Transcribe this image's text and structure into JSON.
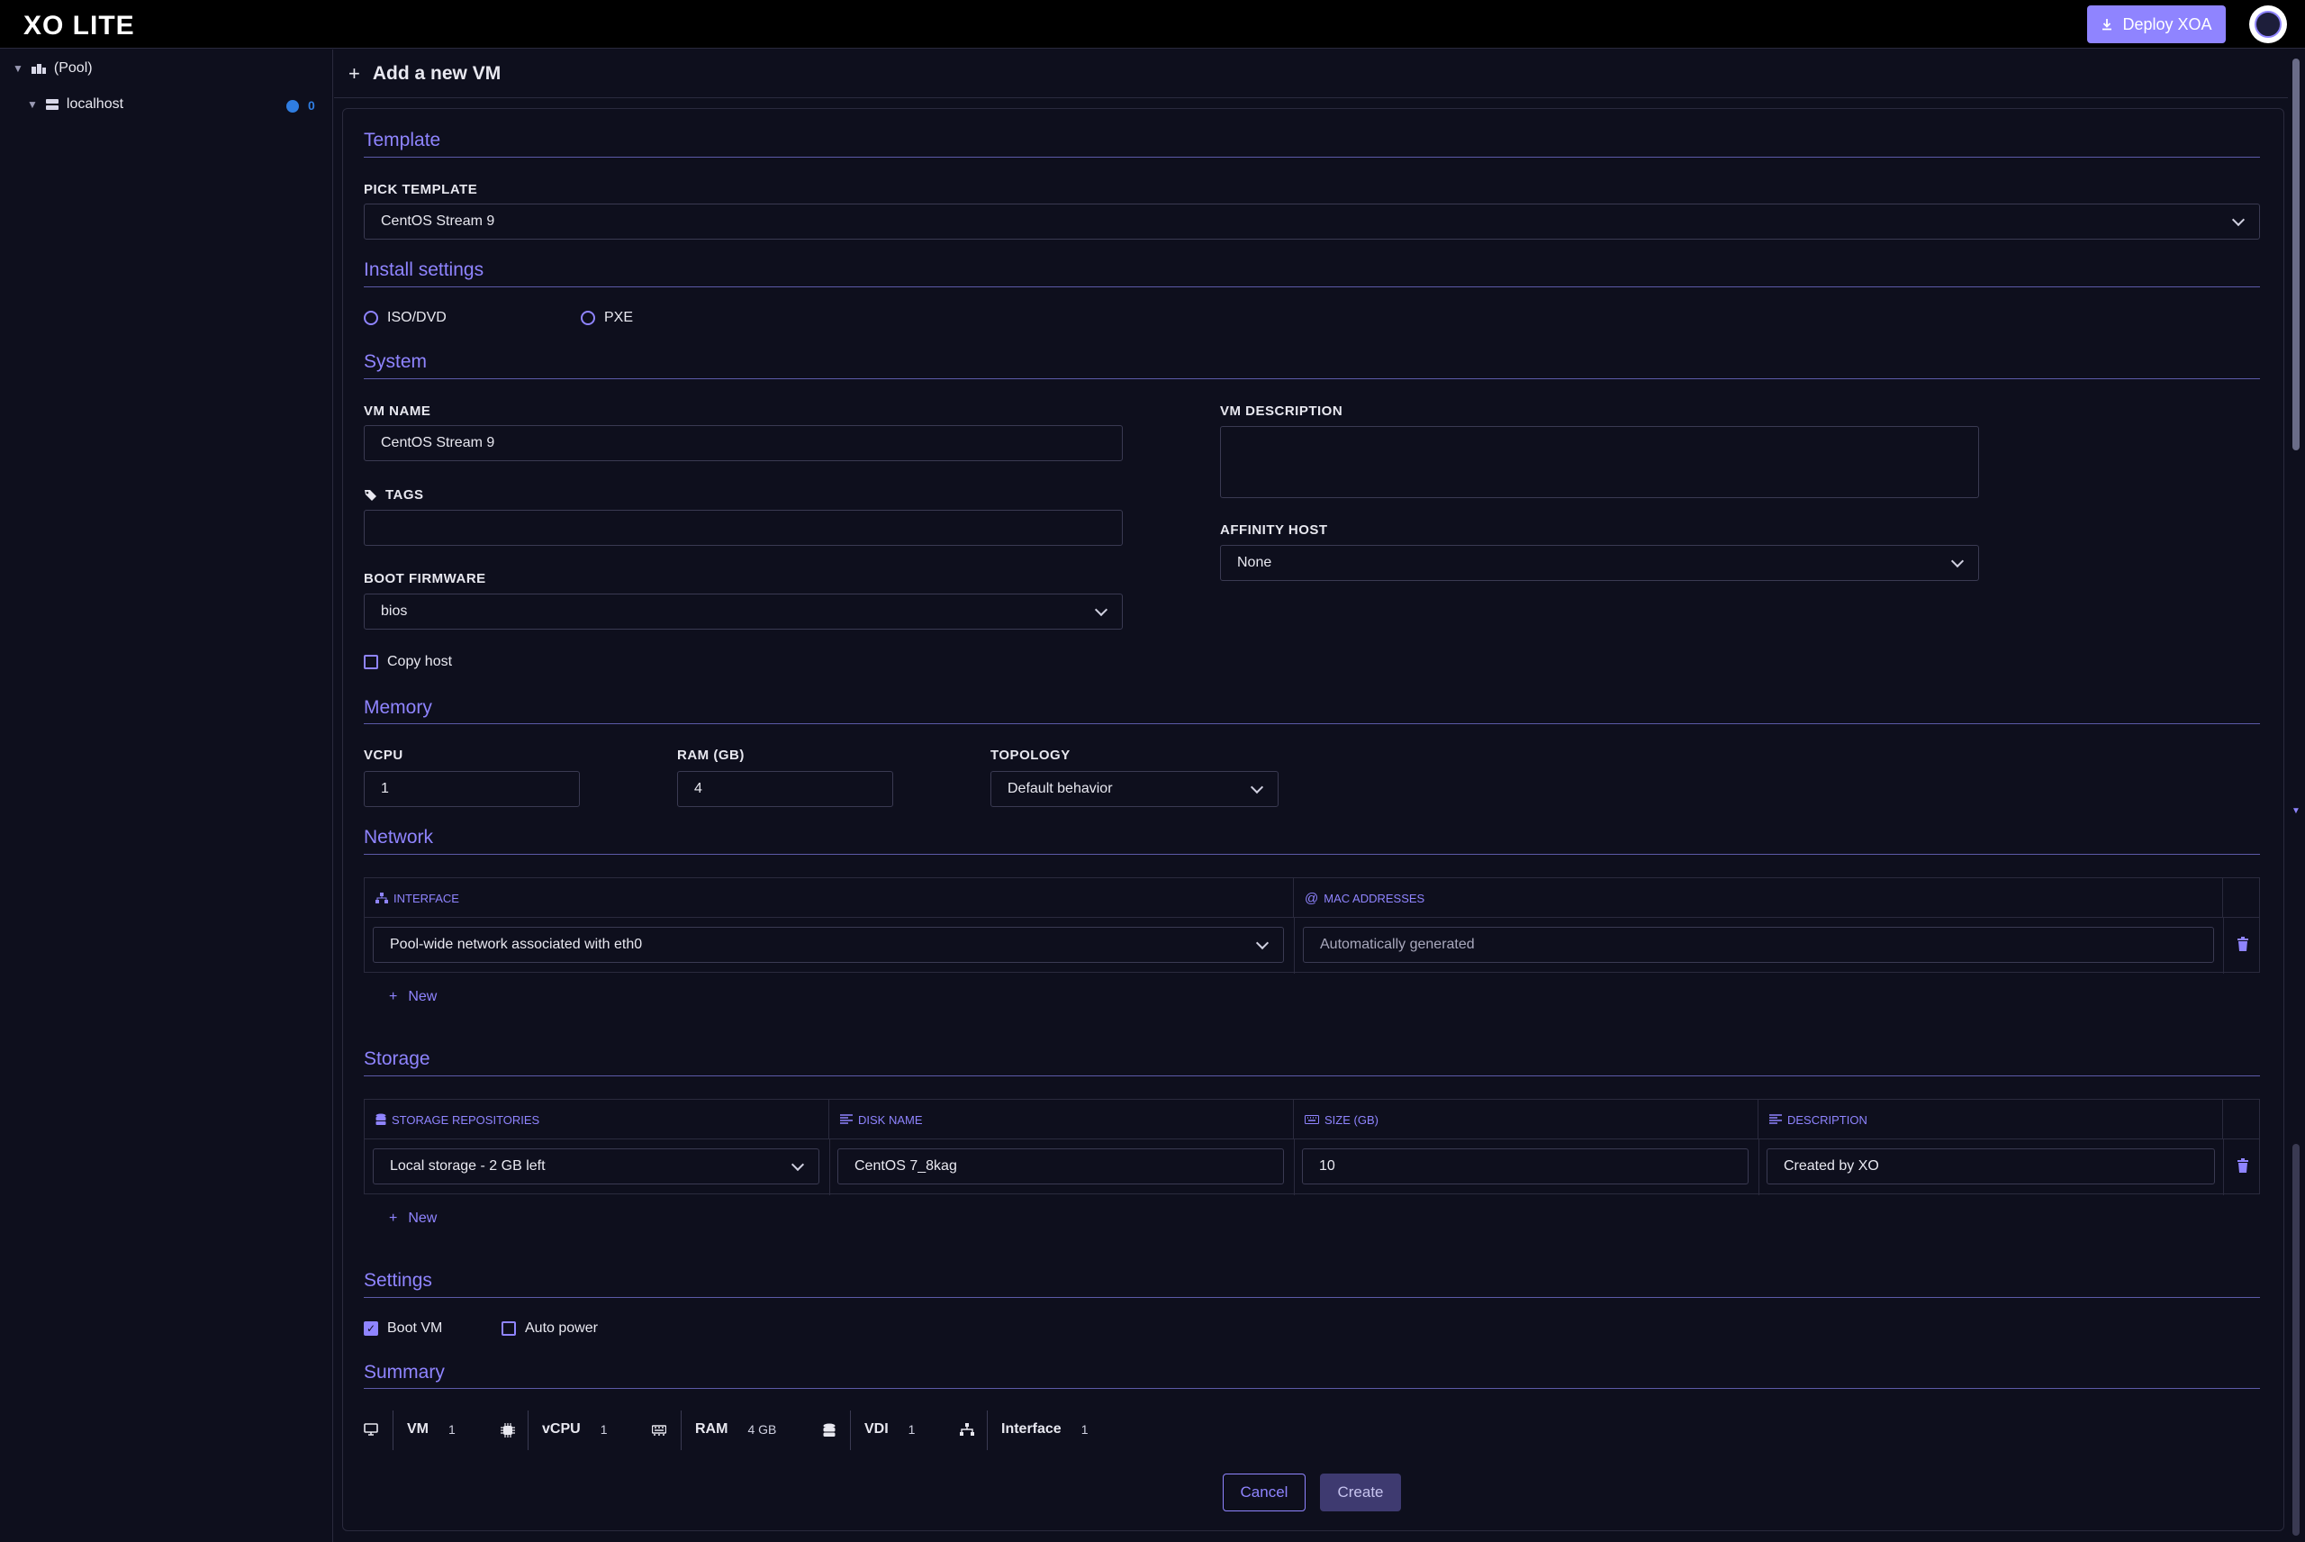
{
  "app": {
    "logo": "XO LITE",
    "deploy_label": "Deploy XOA"
  },
  "sidebar": {
    "pool_label": "(Pool)",
    "host_label": "localhost",
    "host_badge": "0"
  },
  "page": {
    "title": "Add a new VM"
  },
  "sections": {
    "template": "Template",
    "install": "Install settings",
    "system": "System",
    "memory": "Memory",
    "network": "Network",
    "storage": "Storage",
    "settings": "Settings",
    "summary": "Summary"
  },
  "template": {
    "label": "PICK TEMPLATE",
    "value": "CentOS Stream 9"
  },
  "install": {
    "options": [
      "ISO/DVD",
      "PXE"
    ]
  },
  "system": {
    "vm_name_label": "VM NAME",
    "vm_name_value": "CentOS Stream 9",
    "tags_label": "TAGS",
    "tags_value": "",
    "boot_firmware_label": "BOOT FIRMWARE",
    "boot_firmware_value": "bios",
    "copy_host_label": "Copy host",
    "vm_description_label": "VM DESCRIPTION",
    "vm_description_value": "",
    "affinity_label": "AFFINITY HOST",
    "affinity_value": "None"
  },
  "memory": {
    "vcpu_label": "VCPU",
    "vcpu_value": "1",
    "ram_label": "RAM (GB)",
    "ram_value": "4",
    "topology_label": "TOPOLOGY",
    "topology_value": "Default behavior"
  },
  "network": {
    "col_interface": "INTERFACE",
    "col_mac": "MAC ADDRESSES",
    "row_interface": "Pool-wide network associated with eth0",
    "row_mac_placeholder": "Automatically generated",
    "new_label": "New"
  },
  "storage": {
    "col_sr": "STORAGE REPOSITORIES",
    "col_disk": "DISK NAME",
    "col_size": "SIZE (GB)",
    "col_desc": "DESCRIPTION",
    "row_sr": "Local storage - 2 GB left",
    "row_disk": "CentOS 7_8kag",
    "row_size": "10",
    "row_desc": "Created by XO",
    "new_label": "New"
  },
  "settings": {
    "boot_vm_label": "Boot VM",
    "boot_vm_checked": true,
    "auto_power_label": "Auto power",
    "auto_power_checked": false
  },
  "summary": {
    "vm_k": "VM",
    "vm_v": "1",
    "vcpu_k": "vCPU",
    "vcpu_v": "1",
    "ram_k": "RAM",
    "ram_v": "4 GB",
    "vdi_k": "VDI",
    "vdi_v": "1",
    "iface_k": "Interface",
    "iface_v": "1"
  },
  "actions": {
    "cancel": "Cancel",
    "create": "Create"
  },
  "colors": {
    "accent": "#8f84ff",
    "background": "#0e0f1d",
    "border": "#2a2a3d"
  }
}
